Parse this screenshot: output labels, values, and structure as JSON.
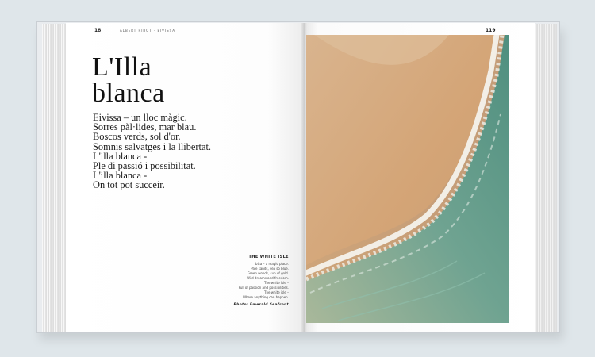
{
  "book": {
    "left_page": {
      "page_number": "18",
      "running_head": "ALBERT RIBOT · EIVISSA",
      "title_lines": [
        "L'Illa",
        "blanca"
      ],
      "poem_lines": [
        "Eivissa – un lloc màgic.",
        "Sorres pàl·lides, mar blau.",
        "Boscos verds, sol d'or.",
        "Somnis salvatges i la llibertat.",
        "L'illa blanca -",
        "Ple di passió i possibilitat.",
        "L'illa blanca -",
        "On tot pot succeir."
      ],
      "caption": {
        "title": "THE WHITE ISLE",
        "lines": [
          "Ibiza – a magic place.",
          "Pale sands, sea so blue.",
          "Green woods, sun of gold.",
          "Wild dreams and freedom.",
          "The white isle –",
          "Full of passion and possibilities.",
          "The white isle –",
          "Where anything can happen."
        ],
        "credit": "Photo: Emerald Seafront"
      }
    },
    "right_page": {
      "page_number": "119",
      "photo_alt": "Aerial view of a sandy beach meeting turquoise sea with white surf"
    }
  },
  "colors": {
    "background": "#dfe6ea",
    "sand": "#d7a97c",
    "sea": "#6fa391",
    "foam": "#f4f2ec"
  }
}
